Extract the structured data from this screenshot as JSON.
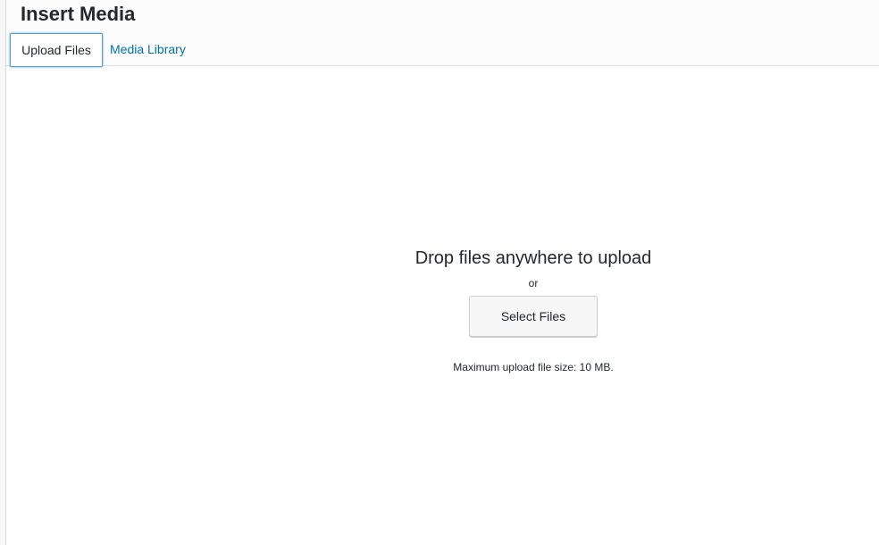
{
  "dialog": {
    "title": "Insert Media"
  },
  "tabs": [
    {
      "label": "Upload Files",
      "active": true
    },
    {
      "label": "Media Library",
      "active": false
    }
  ],
  "uploader": {
    "drop_text": "Drop files anywhere to upload",
    "or_text": "or",
    "select_button_label": "Select Files",
    "max_size_text": "Maximum upload file size: 10 MB."
  },
  "colors": {
    "link": "#0073aa",
    "focus_border": "#5b9dd9",
    "text": "#23282d",
    "header_bg": "#fcfcfc",
    "border": "#dddddd"
  }
}
